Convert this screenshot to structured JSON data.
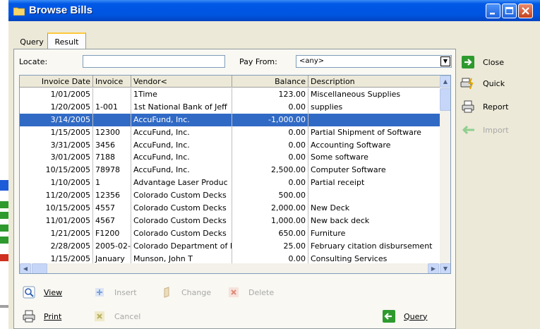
{
  "window": {
    "title": "Browse Bills"
  },
  "tabs": [
    {
      "label": "Query"
    },
    {
      "label": "Result"
    }
  ],
  "filters": {
    "locate_label": "Locate:",
    "locate_value": "",
    "pay_from_label": "Pay From:",
    "pay_from_value": "<any>"
  },
  "table": {
    "columns": [
      "Invoice Date",
      "Invoice",
      "Vendor<",
      "Balance",
      "Description"
    ],
    "rows": [
      [
        "1/01/2005",
        "",
        "1Time",
        "123.00",
        "Miscellaneous Supplies"
      ],
      [
        "1/20/2005",
        "1-001",
        "1st National Bank of Jeff",
        "0.00",
        "supplies"
      ],
      [
        "3/14/2005",
        "",
        "AccuFund, Inc.",
        "-1,000.00",
        ""
      ],
      [
        "1/15/2005",
        "12300",
        "AccuFund, Inc.",
        "0.00",
        "Partial Shipment of Software"
      ],
      [
        "3/31/2005",
        "3456",
        "AccuFund, Inc.",
        "0.00",
        "Accounting Software"
      ],
      [
        "3/01/2005",
        "7188",
        "AccuFund, Inc.",
        "0.00",
        "Some software"
      ],
      [
        "10/15/2005",
        "78978",
        "AccuFund, Inc.",
        "2,500.00",
        "Computer Software"
      ],
      [
        "1/10/2005",
        "1",
        "Advantage Laser Produc",
        "0.00",
        "Partial receipt"
      ],
      [
        "11/20/2005",
        "12356",
        "Colorado Custom Decks",
        "500.00",
        ""
      ],
      [
        "10/15/2005",
        "4557",
        "Colorado Custom Decks",
        "2,000.00",
        "New Deck"
      ],
      [
        "11/01/2005",
        "4567",
        "Colorado Custom Decks",
        "1,000.00",
        "New back deck"
      ],
      [
        "1/21/2005",
        "F1200",
        "Colorado Custom Decks",
        "650.00",
        "Furniture"
      ],
      [
        "2/28/2005",
        "2005-02-",
        "Colorado Department of I",
        "25.00",
        "February citation disbursement"
      ],
      [
        "1/15/2005",
        "January",
        "Munson, John T",
        "0.00",
        "Consulting Services"
      ]
    ],
    "selected_row": 2
  },
  "actions": {
    "view": "View",
    "insert": "Insert",
    "change": "Change",
    "delete": "Delete",
    "print": "Print",
    "cancel": "Cancel",
    "query": "Query"
  },
  "side_actions": {
    "close": "Close",
    "quick": "Quick",
    "report": "Report",
    "import": "Import"
  },
  "colors": {
    "titlebar": "#0055E0",
    "selection": "#316AC5",
    "green_icon": "#2E9A2E"
  }
}
